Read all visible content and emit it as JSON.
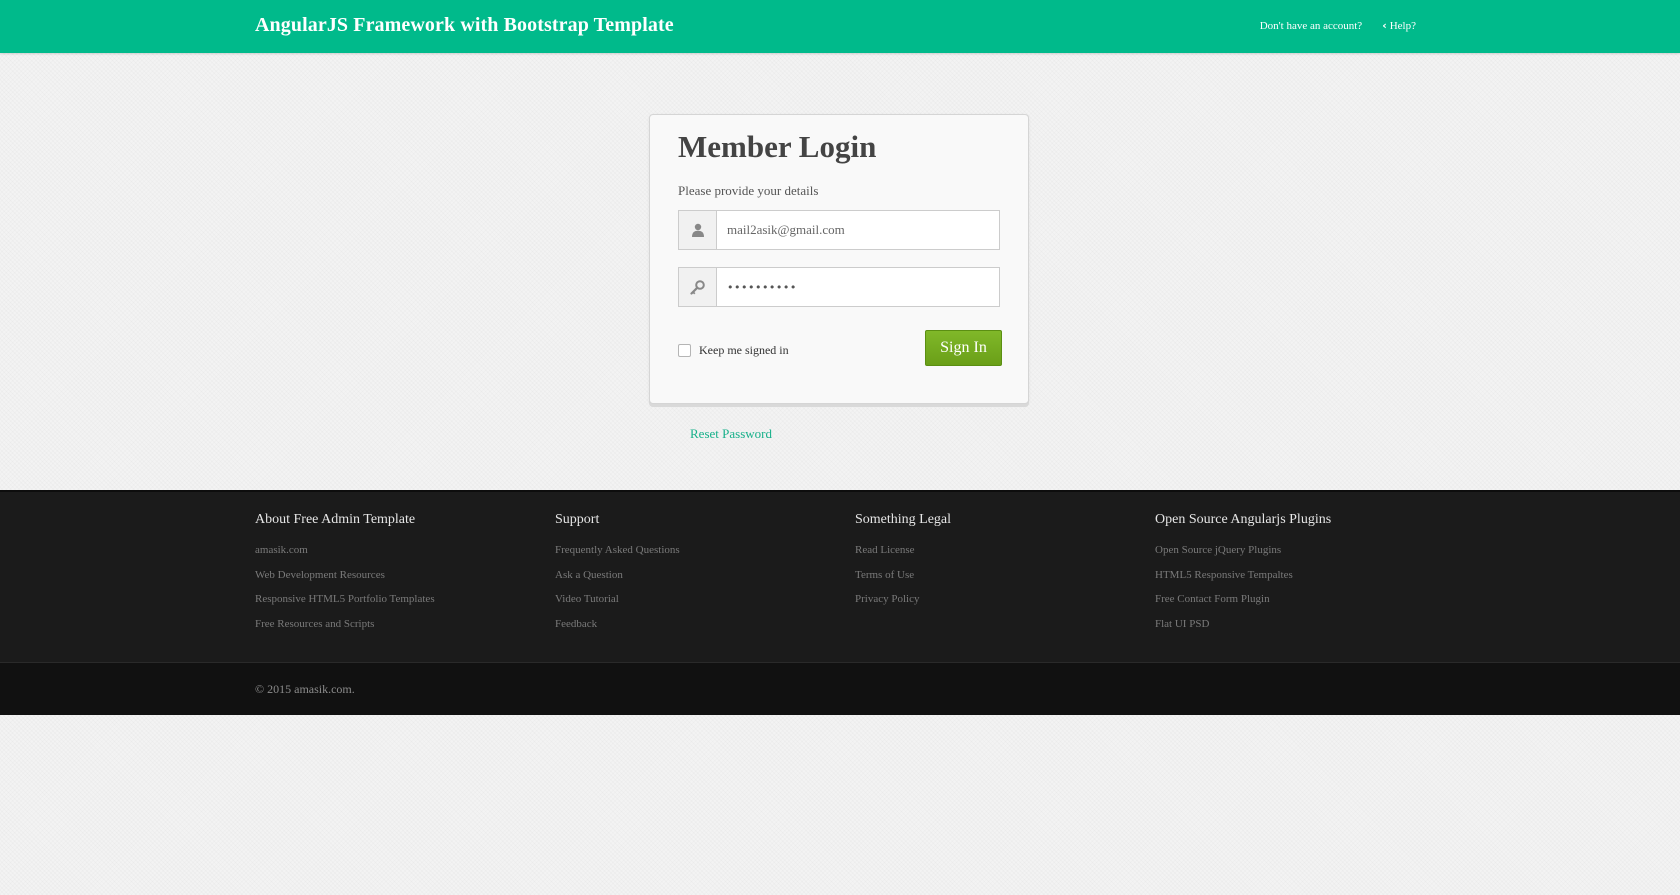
{
  "navbar": {
    "brand": "AngularJS Framework with Bootstrap Template",
    "signup_link": "Don't have an account?",
    "help_link": "Help?",
    "help_icon": "chevron-left-icon",
    "color": "#00ba8b"
  },
  "login": {
    "title": "Member Login",
    "subtitle": "Please provide your details",
    "email": {
      "value": "mail2asik@gmail.com",
      "icon": "user-icon"
    },
    "password": {
      "value": "••••••••••",
      "icon": "key-icon"
    },
    "remember_label": "Keep me signed in",
    "remember_checked": false,
    "signin_label": "Sign In",
    "signin_color": "#76ad1e",
    "reset_link": "Reset Password"
  },
  "footer": {
    "columns": [
      {
        "heading": "About Free Admin Template",
        "links": [
          "amasik.com",
          "Web Development Resources",
          "Responsive HTML5 Portfolio Templates",
          "Free Resources and Scripts"
        ]
      },
      {
        "heading": "Support",
        "links": [
          "Frequently Asked Questions",
          "Ask a Question",
          "Video Tutorial",
          "Feedback"
        ]
      },
      {
        "heading": "Something Legal",
        "links": [
          "Read License",
          "Terms of Use",
          "Privacy Policy"
        ]
      },
      {
        "heading": "Open Source Angularjs Plugins",
        "links": [
          "Open Source jQuery Plugins",
          "HTML5 Responsive Tempaltes",
          "Free Contact Form Plugin",
          "Flat UI PSD"
        ]
      }
    ],
    "copyright": "© 2015 amasik.com."
  }
}
